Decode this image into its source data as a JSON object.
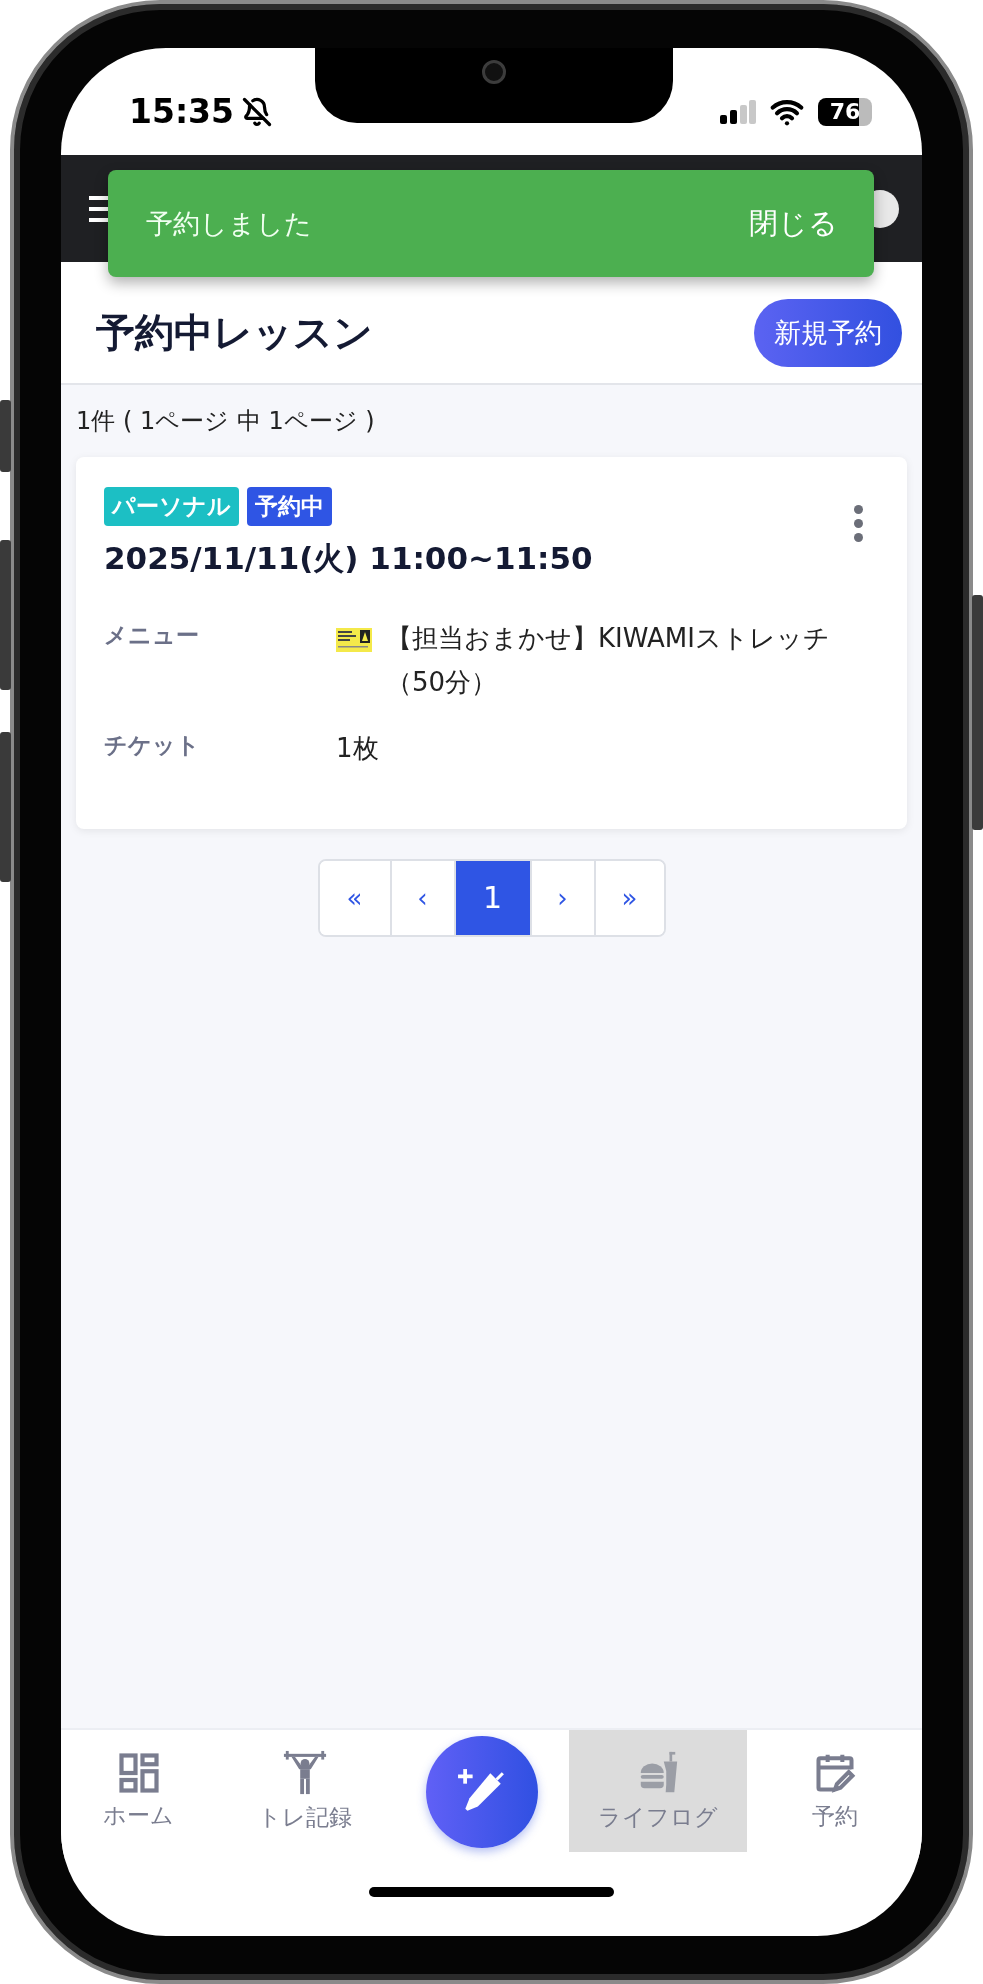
{
  "status_bar": {
    "time": "15:35",
    "battery": "76"
  },
  "toast": {
    "message": "予約しました",
    "close": "閉じる"
  },
  "page": {
    "title": "予約中レッスン",
    "new_button": "新規予約"
  },
  "summary": "1件 ( 1ページ 中 1ページ )",
  "reservations": [
    {
      "tags": [
        {
          "label": "パーソナル",
          "color": "#1cbfc4"
        },
        {
          "label": "予約中",
          "color": "#2f55e4"
        }
      ],
      "datetime": "2025/11/11(火) 11:00~11:50",
      "fields": [
        {
          "label": "メニュー",
          "value": "【担当おまかせ】KIWAMIストレッチ（50分）",
          "kind": "thumbnail"
        },
        {
          "label": "チケット",
          "value": "1枚",
          "kind": "plain"
        }
      ]
    }
  ],
  "pagination": [
    {
      "label": "«",
      "selected": false
    },
    {
      "label": "‹",
      "selected": false
    },
    {
      "label": "1",
      "selected": true
    },
    {
      "label": "›",
      "selected": false
    },
    {
      "label": "»",
      "selected": false
    }
  ],
  "bottom_nav": [
    {
      "kind": "home",
      "label": "ホーム",
      "selected": false
    },
    {
      "kind": "training",
      "label": "トレ記録",
      "selected": false
    },
    {
      "kind": "fab",
      "selected": false
    },
    {
      "kind": "lifelog",
      "label": "ライフログ",
      "selected": true
    },
    {
      "kind": "reserve",
      "label": "予約",
      "selected": false
    }
  ]
}
